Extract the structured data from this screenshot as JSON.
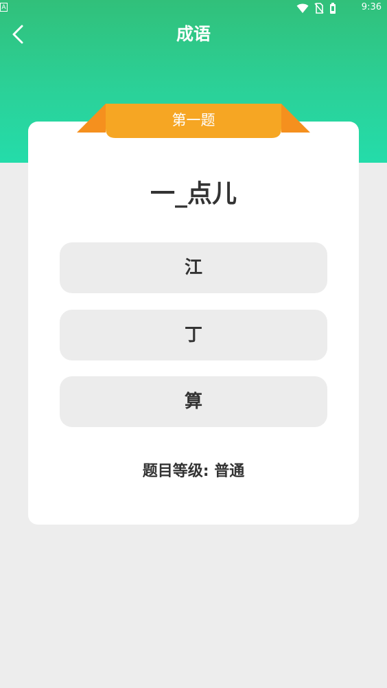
{
  "status_bar": {
    "left_badge": "A",
    "time": "9:36",
    "icons": [
      "wifi-icon",
      "no-sim-icon",
      "battery-icon"
    ]
  },
  "nav": {
    "title": "成语",
    "back_icon": "chevron-left-icon"
  },
  "quiz": {
    "question_number": "第一题",
    "question": "一_点儿",
    "options": [
      "江",
      "丁",
      "算"
    ],
    "level_text": "题目等级: 普通"
  },
  "colors": {
    "header_gradient_top": "#31c07a",
    "header_gradient_bottom": "#24dcaa",
    "ribbon_orange": "#f6a623",
    "option_bg": "#ececec",
    "page_bg": "#ededed"
  }
}
